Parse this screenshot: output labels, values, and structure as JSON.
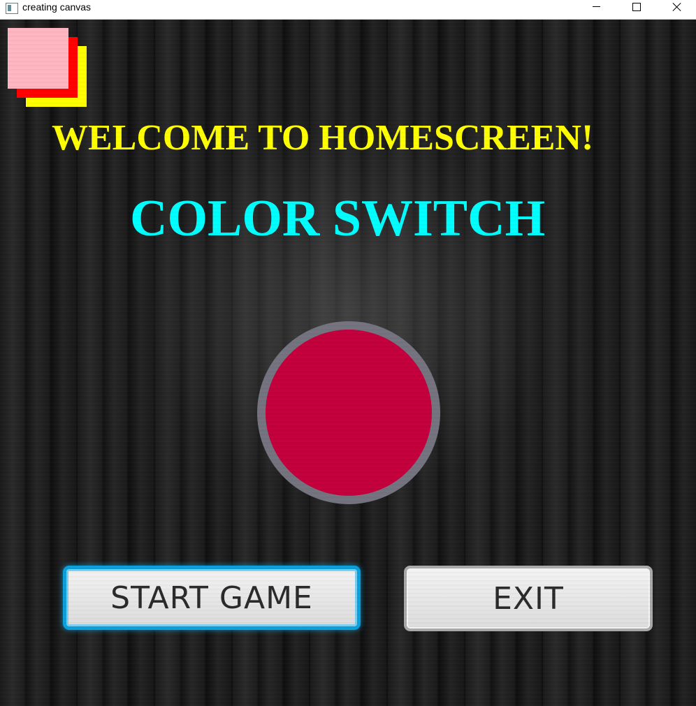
{
  "window": {
    "title": "creating canvas",
    "icon": "app-window-icon",
    "controls": [
      "minimize",
      "maximize",
      "close"
    ]
  },
  "logo": {
    "icon": "color-switch-logo-squares",
    "colors": [
      "#ffb6c1",
      "#ff0000",
      "#ffff00"
    ]
  },
  "home": {
    "welcome": "WELCOME TO HOMESCREEN!",
    "game_title": "COLOR SWITCH",
    "welcome_color": "#ffff00",
    "title_color": "#00ffff"
  },
  "ball": {
    "fill": "#c3003c",
    "ring": "#74737f"
  },
  "buttons": {
    "start_label": "START GAME",
    "exit_label": "EXIT"
  }
}
